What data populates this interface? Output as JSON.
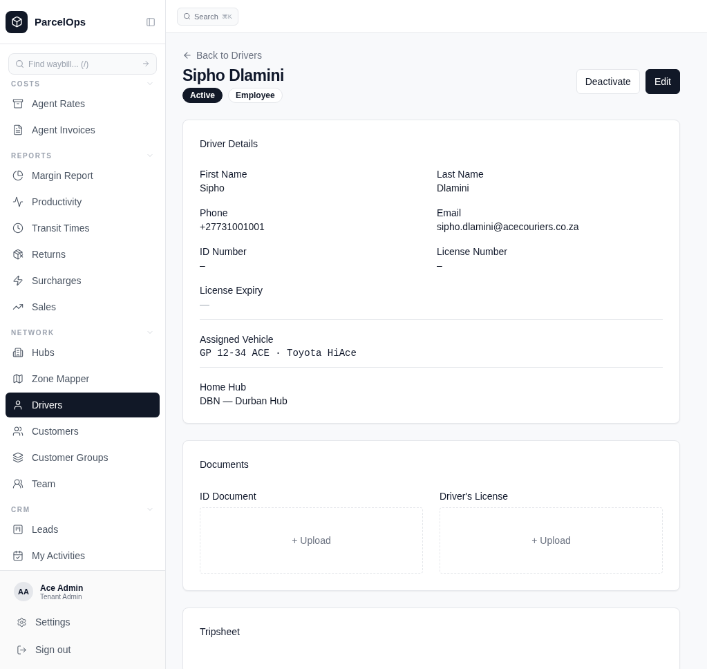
{
  "brand": {
    "name": "ParcelOps"
  },
  "topbar": {
    "search": {
      "placeholder": "Search",
      "shortcut": "⌘K"
    }
  },
  "sidebar": {
    "search": {
      "placeholder": "Find waybill... (/)"
    },
    "sections": [
      {
        "title": "COSTS",
        "expanded": true,
        "items": [
          {
            "label": "Agent Rates",
            "selected": false
          },
          {
            "label": "Agent Invoices",
            "selected": false
          }
        ]
      },
      {
        "title": "REPORTS",
        "expanded": true,
        "items": [
          {
            "label": "Margin Report",
            "selected": false
          },
          {
            "label": "Productivity",
            "selected": false
          },
          {
            "label": "Transit Times",
            "selected": false
          },
          {
            "label": "Returns",
            "selected": false
          },
          {
            "label": "Surcharges",
            "selected": false
          },
          {
            "label": "Sales",
            "selected": false
          }
        ]
      },
      {
        "title": "NETWORK",
        "expanded": true,
        "items": [
          {
            "label": "Hubs",
            "selected": false
          },
          {
            "label": "Zone Mapper",
            "selected": false
          },
          {
            "label": "Drivers",
            "selected": true
          },
          {
            "label": "Customers",
            "selected": false
          },
          {
            "label": "Customer Groups",
            "selected": false
          },
          {
            "label": "Team",
            "selected": false
          }
        ]
      },
      {
        "title": "CRM",
        "expanded": true,
        "items": [
          {
            "label": "Leads",
            "selected": false
          },
          {
            "label": "My Activities",
            "selected": false
          }
        ]
      }
    ],
    "user": {
      "initials": "AA",
      "name": "Ace Admin",
      "role": "Tenant Admin"
    },
    "footer_items": [
      {
        "label": "Settings"
      },
      {
        "label": "Sign out"
      }
    ]
  },
  "page": {
    "back_link": "Back to Drivers",
    "title": "Sipho Dlamini",
    "badges": [
      {
        "label": "Active",
        "kind": "solid"
      },
      {
        "label": "Employee",
        "kind": "outline"
      }
    ],
    "actions": [
      {
        "label": "Deactivate",
        "kind": "outline"
      },
      {
        "label": "Edit",
        "kind": "solid"
      }
    ]
  },
  "details": {
    "title": "Driver Details",
    "fields": [
      {
        "label": "First Name",
        "value": "Sipho",
        "muted": false
      },
      {
        "label": "Last Name",
        "value": "Dlamini",
        "muted": false
      },
      {
        "label": "Phone",
        "value": "+27731001001",
        "muted": false
      },
      {
        "label": "Email",
        "value": "sipho.dlamini@acecouriers.co.za",
        "muted": false
      },
      {
        "label": "ID Number",
        "value": "–",
        "muted": false
      },
      {
        "label": "License Number",
        "value": "–",
        "muted": false
      },
      {
        "label": "License Expiry",
        "value": "—",
        "muted": true
      }
    ],
    "vehicle": {
      "label": "Assigned Vehicle",
      "value": "GP 12-34 ACE · Toyota HiAce"
    },
    "home_hub": {
      "label": "Home Hub",
      "value": "DBN — Durban Hub"
    }
  },
  "documents": {
    "title": "Documents",
    "items": [
      {
        "label": "ID Document",
        "action": "+ Upload"
      },
      {
        "label": "Driver's License",
        "action": "+ Upload"
      }
    ]
  },
  "tripsheet": {
    "title": "Tripsheet"
  }
}
